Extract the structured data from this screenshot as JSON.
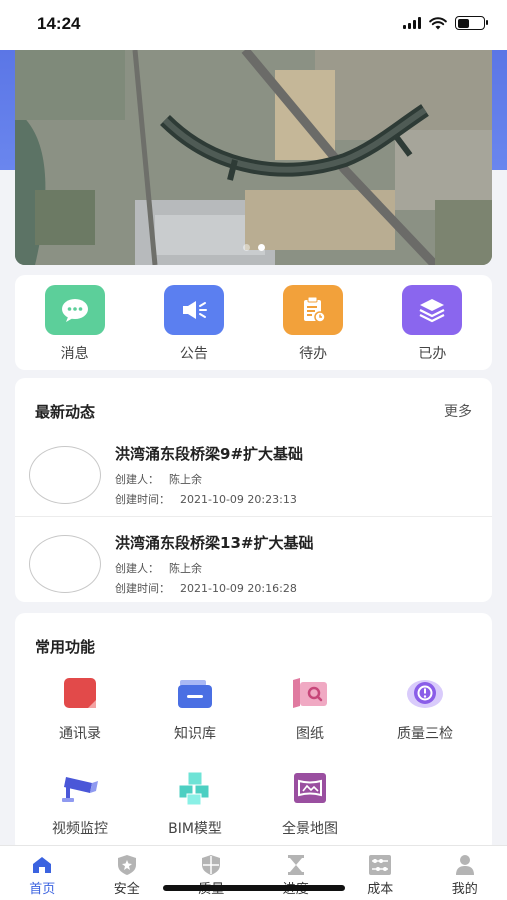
{
  "status_bar": {
    "time": "14:24",
    "battery_level": 0.45
  },
  "banner": {
    "dots": 2,
    "active_dot": 1
  },
  "quick_actions": [
    {
      "label": "消息",
      "icon": "chat-bubble-icon",
      "color": "#5ccf9a"
    },
    {
      "label": "公告",
      "icon": "megaphone-icon",
      "color": "#5b7ff0"
    },
    {
      "label": "待办",
      "icon": "todo-clipboard-icon",
      "color": "#f2a13b"
    },
    {
      "label": "已办",
      "icon": "layers-icon",
      "color": "#8a66ee"
    }
  ],
  "news": {
    "title": "最新动态",
    "more": "更多",
    "items": [
      {
        "title": "洪湾涌东段桥梁9#扩大基础",
        "creator_label": "创建人：",
        "creator": "陈上余",
        "time_label": "创建时间：",
        "time": "2021-10-09 20:23:13"
      },
      {
        "title": "洪湾涌东段桥梁13#扩大基础",
        "creator_label": "创建人：",
        "creator": "陈上余",
        "time_label": "创建时间：",
        "time": "2021-10-09 20:16:28"
      }
    ]
  },
  "functions": {
    "title": "常用功能",
    "items": [
      {
        "label": "通讯录",
        "icon": "contacts-book-icon",
        "color": "#e24a4a"
      },
      {
        "label": "知识库",
        "icon": "knowledge-folder-icon",
        "color": "#4a6fe3"
      },
      {
        "label": "图纸",
        "icon": "blueprint-icon",
        "color": "#e07aa0"
      },
      {
        "label": "质量三检",
        "icon": "quality-check-icon",
        "color": "#8a5de8"
      },
      {
        "label": "视频监控",
        "icon": "cctv-camera-icon",
        "color": "#4a57d8"
      },
      {
        "label": "BIM模型",
        "icon": "bim-cubes-icon",
        "color": "#4ccfc2"
      },
      {
        "label": "全景地图",
        "icon": "panorama-map-icon",
        "color": "#9a4fa0"
      }
    ]
  },
  "tabs": [
    {
      "label": "首页",
      "icon": "home-icon",
      "active": true
    },
    {
      "label": "安全",
      "icon": "shield-icon",
      "active": false
    },
    {
      "label": "质量",
      "icon": "quality-shield-icon",
      "active": false
    },
    {
      "label": "进度",
      "icon": "hourglass-icon",
      "active": false
    },
    {
      "label": "成本",
      "icon": "abacus-icon",
      "active": false
    },
    {
      "label": "我的",
      "icon": "user-icon",
      "active": false
    }
  ],
  "colors": {
    "accent": "#3b63e0",
    "header_band": "#5c78e8"
  }
}
